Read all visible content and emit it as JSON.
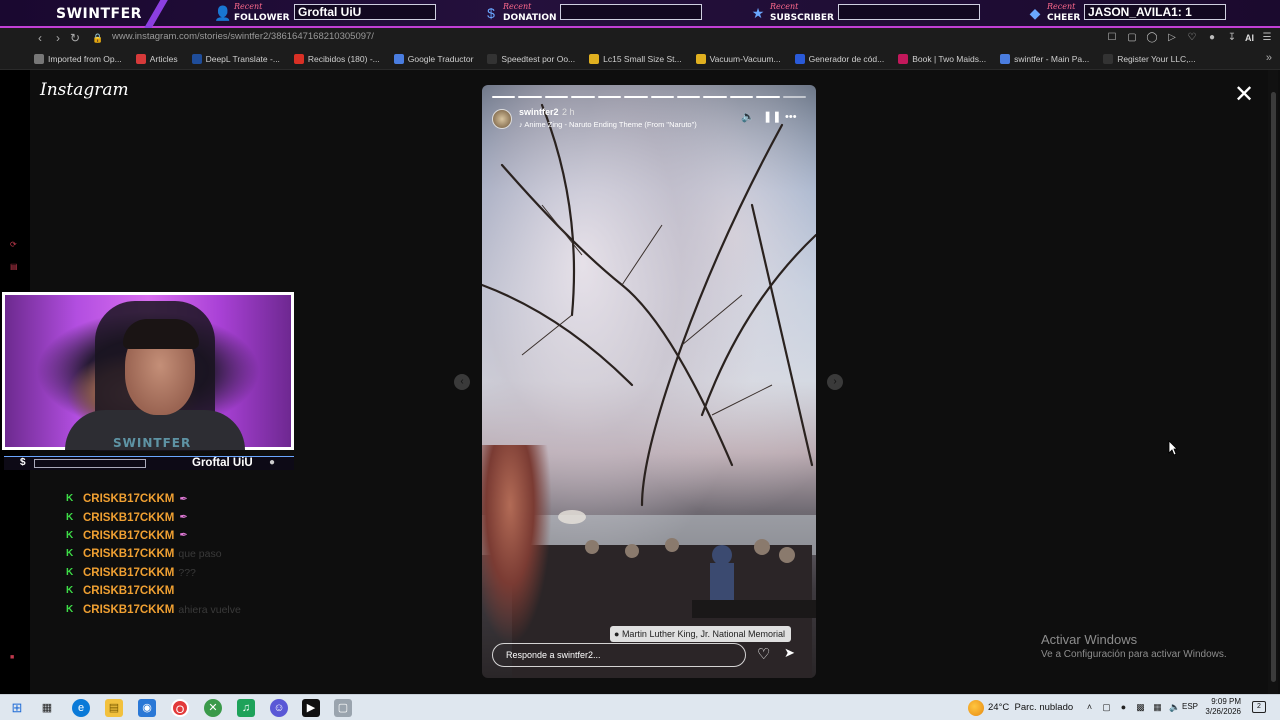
{
  "overlay": {
    "brand": "SWINTFER",
    "recent": "Recent",
    "follower": {
      "label": "FOLLOWER",
      "value": "Groftal UiU"
    },
    "donation": {
      "label": "DONATION",
      "value": ""
    },
    "subscriber": {
      "label": "SUBSCRIBER",
      "value": ""
    },
    "cheer": {
      "label": "CHEER",
      "value": "JASON_AVILA1: 1"
    }
  },
  "browser": {
    "url": "www.instagram.com/stories/swintfer2/3861647168210305097/",
    "ai_label": "AI",
    "bookmarks": [
      {
        "label": "Imported from Op...",
        "icon": "folder-icon",
        "color": "#777777"
      },
      {
        "label": "Articles",
        "icon": "articles-icon",
        "color": "#d63a3a"
      },
      {
        "label": "DeepL Translate -...",
        "icon": "deepl-icon",
        "color": "#1f4d9a"
      },
      {
        "label": "Recibidos (180) -...",
        "icon": "gmail-icon",
        "color": "#d93025"
      },
      {
        "label": "Google Traductor",
        "icon": "translate-icon",
        "color": "#4a7de0"
      },
      {
        "label": "Speedtest por Oo...",
        "icon": "speedtest-icon",
        "color": "#333333"
      },
      {
        "label": "Lc15 Small Size St...",
        "icon": "lc15-icon",
        "color": "#e0b020"
      },
      {
        "label": "Vacuum-Vacuum...",
        "icon": "vacuum-icon",
        "color": "#e0b020"
      },
      {
        "label": "Generador de cód...",
        "icon": "generator-icon",
        "color": "#2a5ad8"
      },
      {
        "label": "Book | Two Maids...",
        "icon": "book-icon",
        "color": "#c2185b"
      },
      {
        "label": "swintfer - Main Pa...",
        "icon": "gear-icon",
        "color": "#4a7de0"
      },
      {
        "label": "Register Your LLC,...",
        "icon": "register-icon",
        "color": "#333333"
      }
    ]
  },
  "instagram": {
    "logo": "Instagram",
    "story": {
      "username": "swintfer2",
      "time": "2 h",
      "music": "Anime Zing - Naruto Ending Theme (From \"Naruto\")",
      "location": "Martin Luther King, Jr. National Memorial",
      "reply_placeholder": "Responde a swintfer2...",
      "progress_segments_done": 11,
      "progress_segments_total": 12
    }
  },
  "stream": {
    "cam_text": "SWINTFER",
    "follower_name": "Groftal UiU",
    "chat": [
      {
        "name": "CRISKB17CKKM",
        "msg": "",
        "feather": true
      },
      {
        "name": "CRISKB17CKKM",
        "msg": "",
        "feather": true
      },
      {
        "name": "CRISKB17CKKM",
        "msg": "",
        "feather": true
      },
      {
        "name": "CRISKB17CKKM",
        "msg": "que paso",
        "feather": false
      },
      {
        "name": "CRISKB17CKKM",
        "msg": "???",
        "feather": false
      },
      {
        "name": "CRISKB17CKKM",
        "msg": "",
        "feather": false
      },
      {
        "name": "CRISKB17CKKM",
        "msg": "ahiera vuelve",
        "feather": false
      }
    ]
  },
  "windows": {
    "activate_title": "Activar Windows",
    "activate_sub": "Ve a Configuración para activar Windows.",
    "temperature": "24°C",
    "weather": "Parc. nublado",
    "lang": "ESP",
    "time": "9:09 PM",
    "date": "3/26/2026",
    "notification_count": "2"
  }
}
